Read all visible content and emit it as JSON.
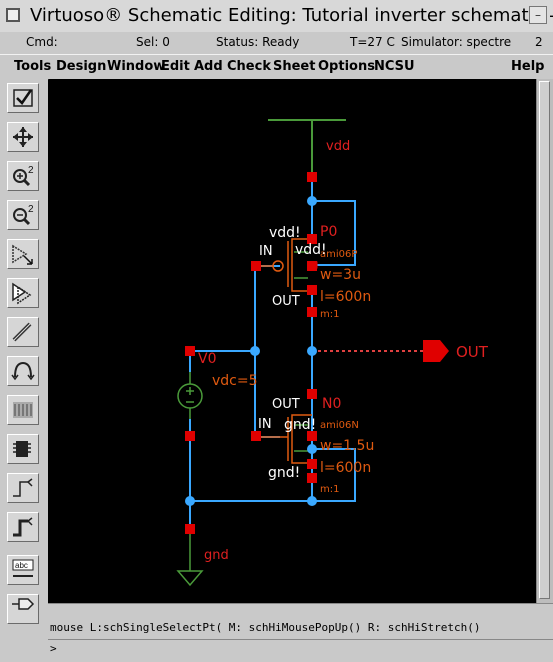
{
  "window": {
    "title": "Virtuoso® Schematic Editing: Tutorial inverter schematic -"
  },
  "statusbar": {
    "cmd": "Cmd:",
    "sel": "Sel: 0",
    "status": "Status: Ready",
    "temp": "T=27 C",
    "simulator": "Simulator: spectre",
    "num": "2"
  },
  "menu": {
    "items": [
      "Tools",
      "Design",
      "Window",
      "Edit",
      "Add",
      "Check",
      "Sheet",
      "Options",
      "NCSU"
    ],
    "help": "Help"
  },
  "toolbar": {
    "icons": [
      "check-icon",
      "fit-icon",
      "zoom-in-2-icon",
      "zoom-out-2-icon",
      "stretch-icon",
      "copy-icon",
      "wire-pencil-icon",
      "delete-icon",
      "undo-icon",
      "properties-icon",
      "instance-icon",
      "wire-icon",
      "wide-wire-icon",
      "wire-name-icon",
      "pin-icon"
    ],
    "abc_label": "abc"
  },
  "schematic": {
    "colors": {
      "wire": "#3aa8ff",
      "net": "#4a8a38",
      "label": "#e02020",
      "device": "#e05a10",
      "pin": "#e00000"
    },
    "labels": {
      "vdd_top": "vdd",
      "p_name": "P0",
      "p_model": "ami06P",
      "p_w": "w=3u",
      "p_l": "l=600n",
      "p_m": "m:1",
      "vdd_bang_a": "vdd!",
      "vdd_bang_b": "vdd!",
      "in_p": "IN",
      "out_p": "OUT",
      "out_pin": "OUT",
      "v_name": "V0",
      "v_dc": "vdc=5",
      "out_n": "OUT",
      "n_name": "N0",
      "n_model": "ami06N",
      "n_w": "w=1.5u",
      "n_l": "l=600n",
      "n_m": "m:1",
      "in_n": "IN",
      "gnd_bang_a": "gnd!",
      "gnd_bang_b": "gnd!",
      "gnd": "gnd"
    }
  },
  "mouse_line": "mouse L:schSingleSelectPt( M: schHiMousePopUp() R: schHiStretch()",
  "prompt": ">"
}
